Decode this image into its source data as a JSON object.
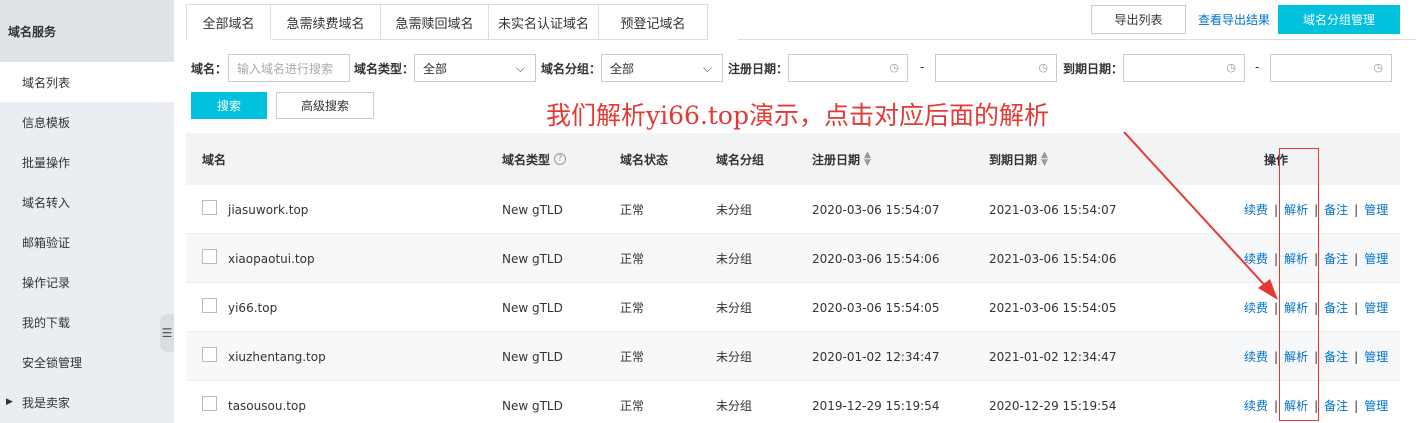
{
  "sidebar": {
    "title": "域名服务",
    "items": [
      {
        "label": "域名列表"
      },
      {
        "label": "信息模板"
      },
      {
        "label": "批量操作"
      },
      {
        "label": "域名转入"
      },
      {
        "label": "邮箱验证"
      },
      {
        "label": "操作记录"
      },
      {
        "label": "我的下载"
      },
      {
        "label": "安全锁管理"
      },
      {
        "label": "我是卖家"
      }
    ],
    "active_index": 0
  },
  "tabs": [
    "全部域名",
    "急需续费域名",
    "急需赎回域名",
    "未实名认证域名",
    "预登记域名"
  ],
  "toolbar": {
    "export_list": "导出列表",
    "view_export": "查看导出结果",
    "group_manage": "域名分组管理"
  },
  "filters": {
    "domain_label": "域名：",
    "domain_placeholder": "输入域名进行搜索",
    "type_label": "域名类型：",
    "type_value": "全部",
    "group_label": "域名分组：",
    "group_value": "全部",
    "reg_date_label": "注册日期：",
    "exp_date_label": "到期日期：",
    "range_sep": "-",
    "search_button": "搜索",
    "advanced_search_button": "高级搜索"
  },
  "table": {
    "columns": {
      "domain": "域名",
      "type": "域名类型",
      "status": "域名状态",
      "group": "域名分组",
      "reg_date": "注册日期",
      "exp_date": "到期日期",
      "ops": "操作"
    },
    "op_labels": {
      "renew": "续费",
      "dns": "解析",
      "remark": "备注",
      "manage": "管理",
      "sep": "|"
    },
    "rows": [
      {
        "domain": "jiasuwork.top",
        "type": "New gTLD",
        "status": "正常",
        "group": "未分组",
        "reg_date": "2020-03-06 15:54:07",
        "exp_date": "2021-03-06 15:54:07"
      },
      {
        "domain": "xiaopaotui.top",
        "type": "New gTLD",
        "status": "正常",
        "group": "未分组",
        "reg_date": "2020-03-06 15:54:06",
        "exp_date": "2021-03-06 15:54:06"
      },
      {
        "domain": "yi66.top",
        "type": "New gTLD",
        "status": "正常",
        "group": "未分组",
        "reg_date": "2020-03-06 15:54:05",
        "exp_date": "2021-03-06 15:54:05"
      },
      {
        "domain": "xiuzhentang.top",
        "type": "New gTLD",
        "status": "正常",
        "group": "未分组",
        "reg_date": "2020-01-02 12:34:47",
        "exp_date": "2021-01-02 12:34:47"
      },
      {
        "domain": "tasousou.top",
        "type": "New gTLD",
        "status": "正常",
        "group": "未分组",
        "reg_date": "2019-12-29 15:19:54",
        "exp_date": "2020-12-29 15:19:54"
      }
    ]
  },
  "annotation": {
    "text": "我们解析yi66.top演示，点击对应后面的解析",
    "color": "#e53935"
  },
  "colors": {
    "primary": "#00c1de",
    "link": "#0070cc",
    "annotation": "#e53935"
  }
}
